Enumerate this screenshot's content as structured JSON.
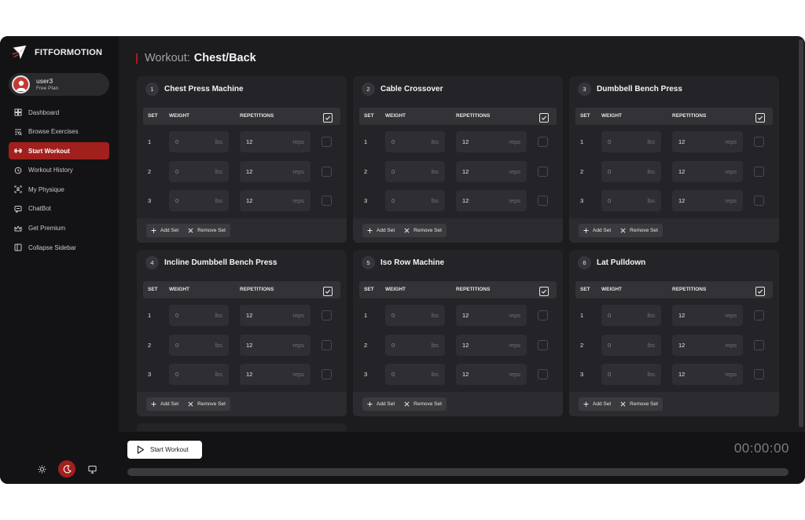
{
  "brand": {
    "name": "FITFORMOTION"
  },
  "user": {
    "name": "user3",
    "plan": "Free Plan"
  },
  "nav": [
    {
      "label": "Dashboard",
      "icon": "dashboard-icon",
      "active": false
    },
    {
      "label": "Browse Exercises",
      "icon": "browse-icon",
      "active": false
    },
    {
      "label": "Start Workout",
      "icon": "dumbbell-icon",
      "active": true
    },
    {
      "label": "Workout History",
      "icon": "history-icon",
      "active": false
    },
    {
      "label": "My Physique",
      "icon": "physique-icon",
      "active": false
    },
    {
      "label": "ChatBot",
      "icon": "chat-icon",
      "active": false
    },
    {
      "label": "Get Premium",
      "icon": "crown-icon",
      "active": false
    },
    {
      "label": "Collapse Sidebar",
      "icon": "collapse-icon",
      "active": false
    }
  ],
  "theme": {
    "active": "dark"
  },
  "page": {
    "title_prefix": "Workout:",
    "title": "Chest/Back"
  },
  "table_headers": {
    "set": "SET",
    "weight": "WEIGHT",
    "reps": "REPETITIONS"
  },
  "units": {
    "weight": "lbs",
    "reps": "reps"
  },
  "buttons": {
    "add_set": "Add Set",
    "remove_set": "Remove Set",
    "start_workout": "Start Workout"
  },
  "exercises": [
    {
      "num": "1",
      "name": "Chest Press Machine",
      "sets": [
        {
          "set": "1",
          "weight": "0",
          "reps": "12"
        },
        {
          "set": "2",
          "weight": "0",
          "reps": "12"
        },
        {
          "set": "3",
          "weight": "0",
          "reps": "12"
        }
      ]
    },
    {
      "num": "2",
      "name": "Cable Crossover",
      "sets": [
        {
          "set": "1",
          "weight": "0",
          "reps": "12"
        },
        {
          "set": "2",
          "weight": "0",
          "reps": "12"
        },
        {
          "set": "3",
          "weight": "0",
          "reps": "12"
        }
      ]
    },
    {
      "num": "3",
      "name": "Dumbbell Bench Press",
      "sets": [
        {
          "set": "1",
          "weight": "0",
          "reps": "12"
        },
        {
          "set": "2",
          "weight": "0",
          "reps": "12"
        },
        {
          "set": "3",
          "weight": "0",
          "reps": "12"
        }
      ]
    },
    {
      "num": "4",
      "name": "Incline Dumbbell Bench Press",
      "sets": [
        {
          "set": "1",
          "weight": "0",
          "reps": "12"
        },
        {
          "set": "2",
          "weight": "0",
          "reps": "12"
        },
        {
          "set": "3",
          "weight": "0",
          "reps": "12"
        }
      ]
    },
    {
      "num": "5",
      "name": "Iso Row Machine",
      "sets": [
        {
          "set": "1",
          "weight": "0",
          "reps": "12"
        },
        {
          "set": "2",
          "weight": "0",
          "reps": "12"
        },
        {
          "set": "3",
          "weight": "0",
          "reps": "12"
        }
      ]
    },
    {
      "num": "6",
      "name": "Lat Pulldown",
      "sets": [
        {
          "set": "1",
          "weight": "0",
          "reps": "12"
        },
        {
          "set": "2",
          "weight": "0",
          "reps": "12"
        },
        {
          "set": "3",
          "weight": "0",
          "reps": "12"
        }
      ]
    }
  ],
  "timer": "00:00:00",
  "progress": 0,
  "colors": {
    "accent": "#a1201e",
    "background": "#131315",
    "card": "#242428"
  }
}
